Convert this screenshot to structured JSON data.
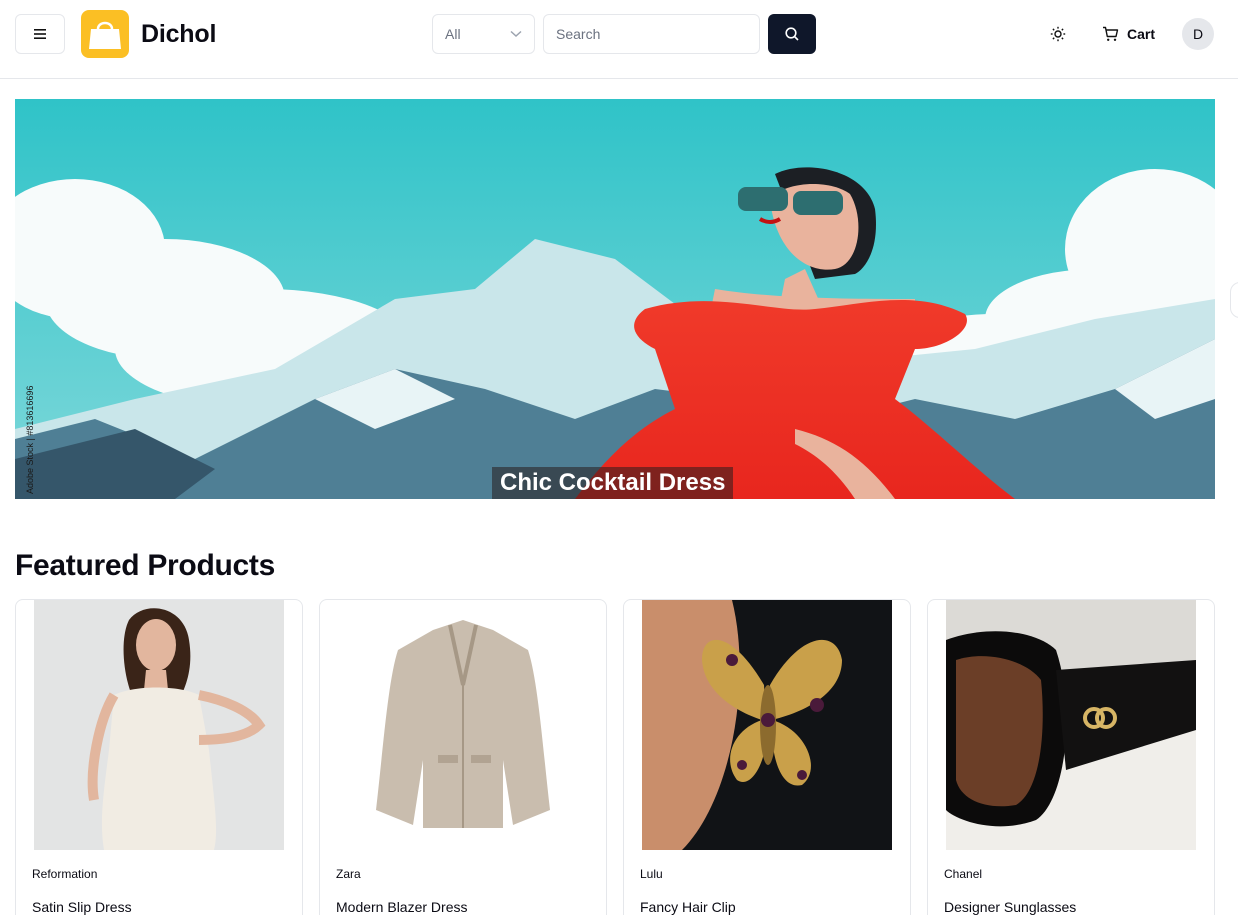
{
  "header": {
    "brand": "Dichol",
    "category_value": "All",
    "search_placeholder": "Search",
    "cart_label": "Cart",
    "avatar_initial": "D",
    "logo_color": "#fbbf24",
    "search_button_color": "#0f172a"
  },
  "hero": {
    "caption": "Chic Cocktail Dress",
    "watermark": "Adobe Stock | #813616696"
  },
  "featured": {
    "title": "Featured Products",
    "products": [
      {
        "brand": "Reformation",
        "name": "Satin Slip Dress"
      },
      {
        "brand": "Zara",
        "name": "Modern Blazer Dress"
      },
      {
        "brand": "Lulu",
        "name": "Fancy Hair Clip"
      },
      {
        "brand": "Chanel",
        "name": "Designer Sunglasses"
      }
    ]
  }
}
